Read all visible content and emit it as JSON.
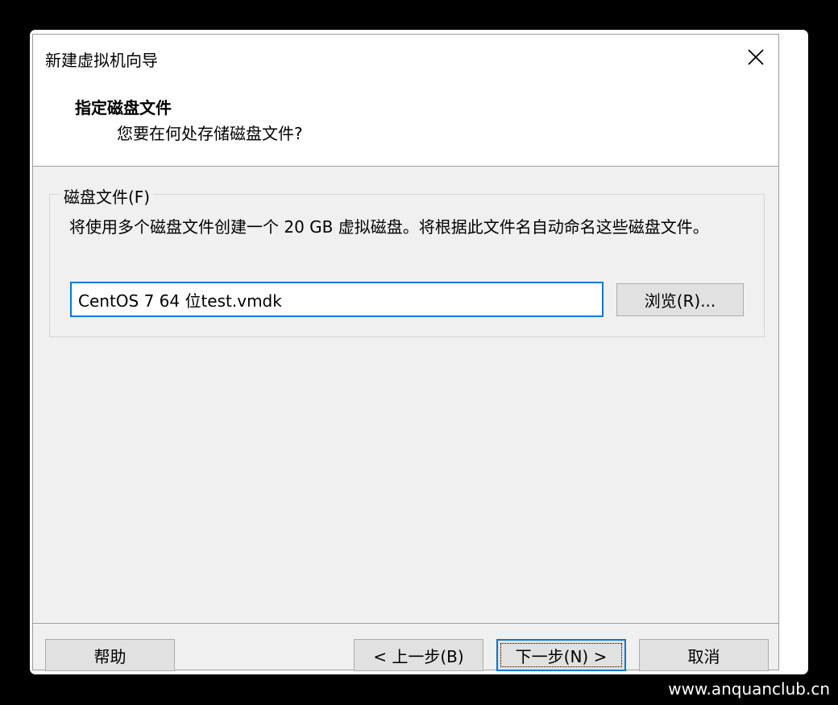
{
  "window": {
    "title": "新建虚拟机向导",
    "close_icon": "close-icon"
  },
  "header": {
    "title": "指定磁盘文件",
    "subtitle": "您要在何处存储磁盘文件?"
  },
  "disk_group": {
    "legend": "磁盘文件(F)",
    "description": "将使用多个磁盘文件创建一个 20 GB 虚拟磁盘。将根据此文件名自动命名这些磁盘文件。",
    "file_value": "CentOS 7 64 位test.vmdk",
    "browse_label": "浏览(R)..."
  },
  "footer": {
    "help_label": "帮助",
    "back_label": "< 上一步(B)",
    "next_label": "下一步(N) >",
    "cancel_label": "取消"
  },
  "watermark": "www.anquanclub.cn",
  "colors": {
    "accent": "#0078d7",
    "dialog_bg": "#f0f0f0",
    "button_bg": "#e1e1e1"
  }
}
